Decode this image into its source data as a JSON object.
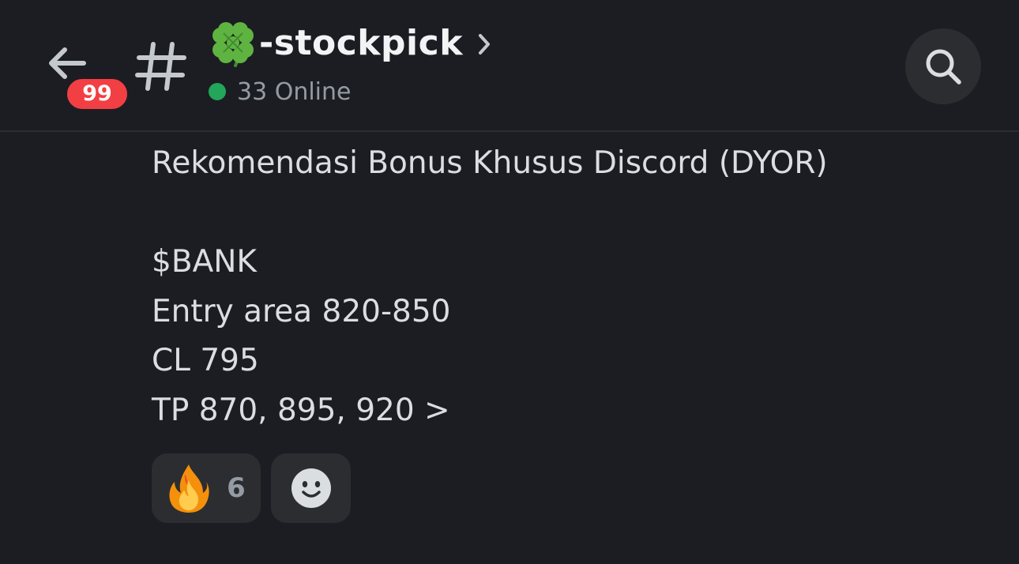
{
  "header": {
    "unread_badge": "99",
    "channel_emoji_icon": "four-leaf-clover-icon",
    "channel_name": "-stockpick",
    "online_count": "33 Online",
    "online_status_color": "#23a55a",
    "badge_color": "#f23f43"
  },
  "message": {
    "lines": [
      "Rekomendasi Bonus Khusus Discord (DYOR)",
      "",
      "$BANK",
      "Entry area 820-850",
      "CL 795",
      "TP 870, 895, 920 >"
    ]
  },
  "reactions": [
    {
      "emoji_icon": "fire-icon",
      "count": "6"
    },
    {
      "emoji_icon": "add-reaction-smiley-icon"
    }
  ]
}
